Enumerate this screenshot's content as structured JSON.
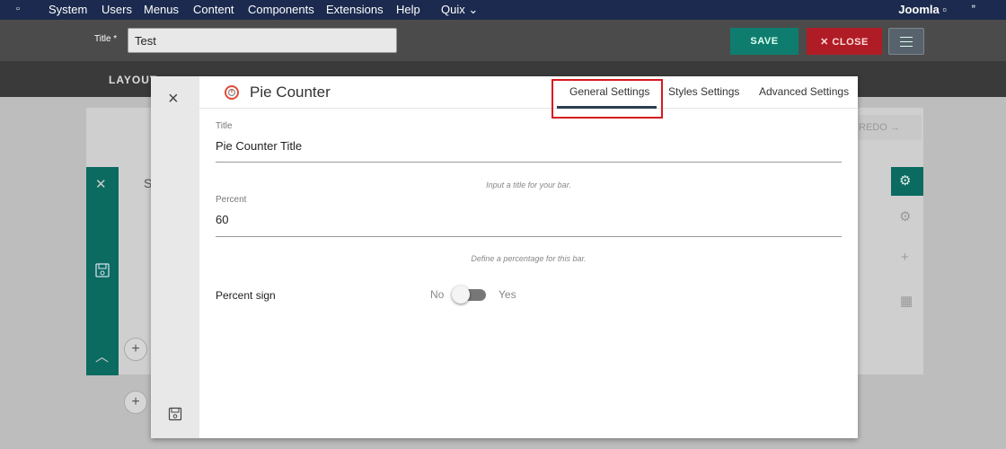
{
  "topbar": {
    "logo_glyph": "▫",
    "menu": [
      "System",
      "Users",
      "Menus",
      "Content",
      "Components",
      "Extensions",
      "Help",
      "Quix ⌄"
    ],
    "brand": "Joomla ▫",
    "ext_glyph": "ˮ"
  },
  "toolbar": {
    "title_label": "Title *",
    "title_value": "Test",
    "save_label": "SAVE",
    "close_label": "✕  CLOSE"
  },
  "subbar": {
    "layout_tab": "LAYOUT"
  },
  "background": {
    "redo_label": "REDO  →",
    "stub_letter": "S"
  },
  "modal": {
    "element_name": "Pie Counter",
    "tabs": [
      "General Settings",
      "Styles Settings",
      "Advanced Settings"
    ],
    "active_tab": "General Settings",
    "fields": {
      "title": {
        "label": "Title",
        "value": "Pie Counter Title",
        "help": "Input a title for your bar."
      },
      "percent": {
        "label": "Percent",
        "value": "60",
        "help": "Define a percentage for this bar."
      },
      "percent_sign": {
        "label": "Percent sign",
        "off_label": "No",
        "on_label": "Yes",
        "enabled": false
      }
    }
  },
  "colors": {
    "topbar_bg": "#1b2a4e",
    "save_green": "#0e7d6f",
    "close_red": "#b01c25",
    "highlight_red": "#d71921",
    "tab_underline": "#2c3e50"
  }
}
